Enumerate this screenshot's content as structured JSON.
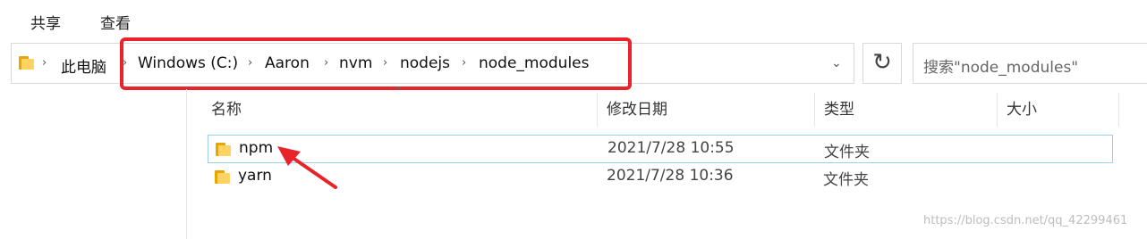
{
  "menubar": {
    "tabs": [
      "共享",
      "查看"
    ]
  },
  "address": {
    "crumbs": [
      "此电脑",
      "Windows (C:)",
      "Aaron",
      "nvm",
      "nodejs",
      "node_modules"
    ],
    "separator": "›",
    "dropdown_icon": "chevron-down-icon"
  },
  "refresh": {
    "icon": "refresh-icon",
    "glyph": "↻"
  },
  "search": {
    "placeholder": "搜索\"node_modules\""
  },
  "columns": {
    "name": "名称",
    "modified": "修改日期",
    "type": "类型",
    "size": "大小"
  },
  "files": [
    {
      "name": "npm",
      "modified": "2021/7/28 10:55",
      "type": "文件夹",
      "size": "",
      "selected": true
    },
    {
      "name": "yarn",
      "modified": "2021/7/28 10:36",
      "type": "文件夹",
      "size": "",
      "selected": false
    }
  ],
  "annotation": {
    "color": "#e8232a"
  },
  "watermark": "https://blog.csdn.net/qq_42299461"
}
